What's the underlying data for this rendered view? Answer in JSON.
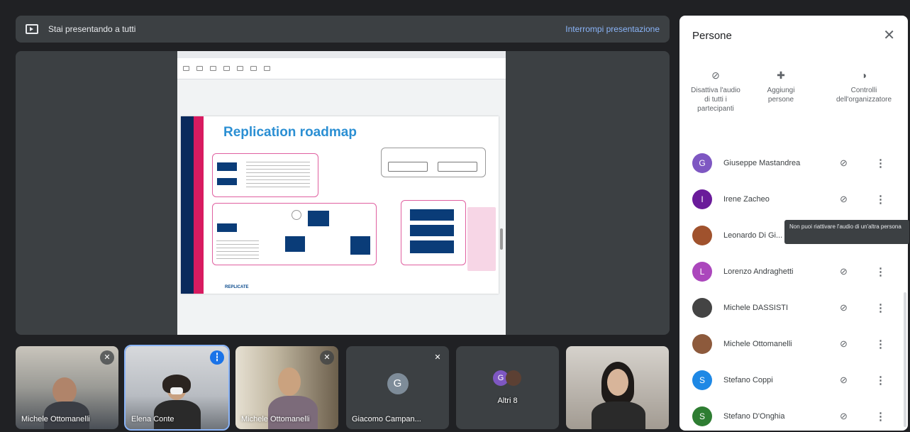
{
  "presenting_bar": {
    "message": "Stai presentando a tutti",
    "stop_label": "Interrompi presentazione"
  },
  "slide": {
    "title": "Replication roadmap",
    "logo_text": "REPLICATE"
  },
  "tiles": [
    {
      "name": "Michele Ottomanelli"
    },
    {
      "name": "Elena Conte"
    },
    {
      "name": "Michele Ottomanelli"
    },
    {
      "name": "Giacomo Campan...",
      "initial": "G"
    },
    {
      "name": "Altri 8",
      "initial": "G"
    },
    {
      "name": ""
    }
  ],
  "panel": {
    "title": "Persone",
    "actions": [
      {
        "label": "Disattiva l'audio di tutti i partecipanti",
        "icon": "mic-off-icon"
      },
      {
        "label": "Aggiungi persone",
        "icon": "add-person-icon"
      },
      {
        "label": "Controlli dell'organizzatore",
        "icon": "toggle-icon"
      }
    ],
    "participants": [
      {
        "name": "Giuseppe Mastandrea",
        "initial": "G",
        "color": "#7e57c2"
      },
      {
        "name": "Irene Zacheo",
        "initial": "I",
        "color": "#6a1b9a"
      },
      {
        "name": "Leonardo Di Gi...",
        "initial": "",
        "color": "#a0522d"
      },
      {
        "name": "Lorenzo Andraghetti",
        "initial": "L",
        "color": "#ab47bc"
      },
      {
        "name": "Michele DASSISTI",
        "initial": "",
        "color": "#444"
      },
      {
        "name": "Michele Ottomanelli",
        "initial": "",
        "color": "#8d5a3c"
      },
      {
        "name": "Stefano Coppi",
        "initial": "S",
        "color": "#1e88e5"
      },
      {
        "name": "Stefano D'Onghia",
        "initial": "S",
        "color": "#2e7d32"
      }
    ],
    "tooltip": "Non puoi riattivare l'audio di un'altra persona"
  }
}
